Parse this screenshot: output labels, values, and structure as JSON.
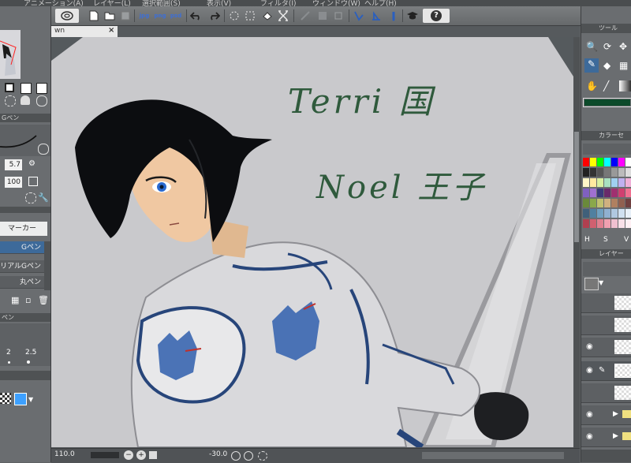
{
  "menu": {
    "items": [
      "アニメーション(A)",
      "レイヤー(L)",
      "選択範囲(S)",
      "表示(V)",
      "フィルタ(I)",
      "ウィンドウ(W)",
      "ヘルプ(H)"
    ]
  },
  "toolbar": {
    "icons": [
      "logo-icon",
      "new-file-icon",
      "open-folder-icon",
      "save-icon",
      "export-jpg-icon",
      "export-png-icon",
      "export-psd-icon",
      "undo-icon",
      "redo-icon",
      "transform-icon",
      "select-icon",
      "fill-icon",
      "crop-icon",
      "snap-off-icon",
      "snap-grid-icon",
      "snap-ruler-icon",
      "pen-pressure-icon",
      "stabilizer-icon",
      "brush-size-icon",
      "learn-icon",
      "help-icon"
    ],
    "labels": {
      "jpg": "jpg",
      "png": "png",
      "psd": "psd",
      "help": "?"
    }
  },
  "document": {
    "tab_label": "wn",
    "tab_close": "×"
  },
  "canvas": {
    "handwriting_line1": "Terri 国",
    "handwriting_line2": "Noel 王子",
    "ink_color": "#2f5a3c"
  },
  "statusbar": {
    "zoom": "110.0",
    "angle": "-30.0"
  },
  "left_panel": {
    "brush_header": "Gペン",
    "size_value": "5.7",
    "density_value": "100",
    "subtool_label": "マーカー",
    "brushes": [
      {
        "label": "Gペン",
        "selected": true
      },
      {
        "label": "リアルGペン",
        "selected": false
      },
      {
        "label": "丸ペン",
        "selected": false
      }
    ],
    "size_header": "ペン",
    "size_presets": [
      "2",
      "2.5"
    ]
  },
  "right_panel": {
    "tool_header": "ツール",
    "color_header": "カラーセ",
    "layer_header": "レイヤー",
    "palette_labels": [
      "H",
      "S",
      "V"
    ],
    "current_color": "#0c4a2a",
    "palette": [
      "#ff0000",
      "#ffff00",
      "#00ff00",
      "#00ffff",
      "#0000ff",
      "#ff00ff",
      "#ffffff",
      "#222222",
      "#333333",
      "#555555",
      "#777777",
      "#999999",
      "#bbbbbb",
      "#dddddd",
      "#fff7c8",
      "#ffe9a0",
      "#d8f0a0",
      "#a8e0c0",
      "#a0d0f0",
      "#c0b0f0",
      "#f0b0d8",
      "#8060c0",
      "#a070d0",
      "#3a3a7a",
      "#6a2a6a",
      "#a03070",
      "#d04070",
      "#f07090",
      "#6a8a3a",
      "#8aa84a",
      "#c0c070",
      "#d0b080",
      "#b08060",
      "#906050",
      "#704040",
      "#40607a",
      "#5080a0",
      "#70a0c0",
      "#90b0d0",
      "#b0c8e0",
      "#d0e0f0",
      "#e8f0f8",
      "#b04050",
      "#d06070",
      "#e08090",
      "#f0a0b0",
      "#f0c0d0",
      "#f8e0e8",
      "#fff0f4"
    ]
  }
}
